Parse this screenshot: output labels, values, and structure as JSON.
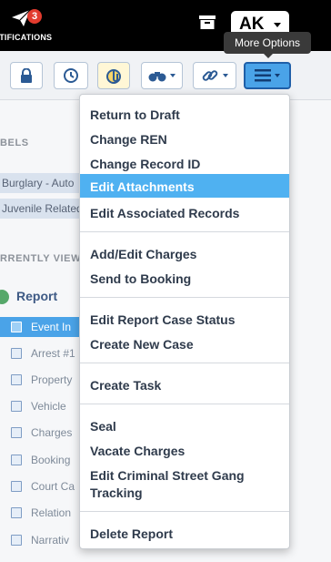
{
  "topbar": {
    "notifications": {
      "count": "3",
      "label": "OTIFICATIONS"
    },
    "user_initials": "AK"
  },
  "tooltip": "More Options",
  "toolbar": {
    "buttons": [
      "lock",
      "history",
      "attachments",
      "binoculars",
      "link",
      "more-options"
    ]
  },
  "sidebar": {
    "labels_heading": "BELS",
    "labels": [
      "Burglary - Auto",
      "Juvenile Related"
    ],
    "currently_viewing_heading": "RRENTLY VIEW",
    "report": "Report",
    "tree": [
      "Event In",
      "Arrest #1",
      "Property",
      "Vehicle",
      "Charges",
      "Booking",
      "Court Ca",
      "Relation",
      "Narrativ"
    ]
  },
  "menu": {
    "items": [
      "Return to Draft",
      "Change REN",
      "Change Record ID",
      "Edit Attachments",
      "Edit Associated Records",
      "Add/Edit Charges",
      "Send to Booking",
      "Edit Report Case Status",
      "Create New Case",
      "Create Task",
      "Seal",
      "Vacate Charges",
      "Edit Criminal Street Gang Tracking",
      "Delete Report"
    ],
    "highlighted": "Edit Attachments"
  },
  "colors": {
    "accent": "#4fb1f1",
    "topbar": "#000000",
    "badge": "#e23b2e",
    "toolbar_icon": "#2b5a94"
  }
}
